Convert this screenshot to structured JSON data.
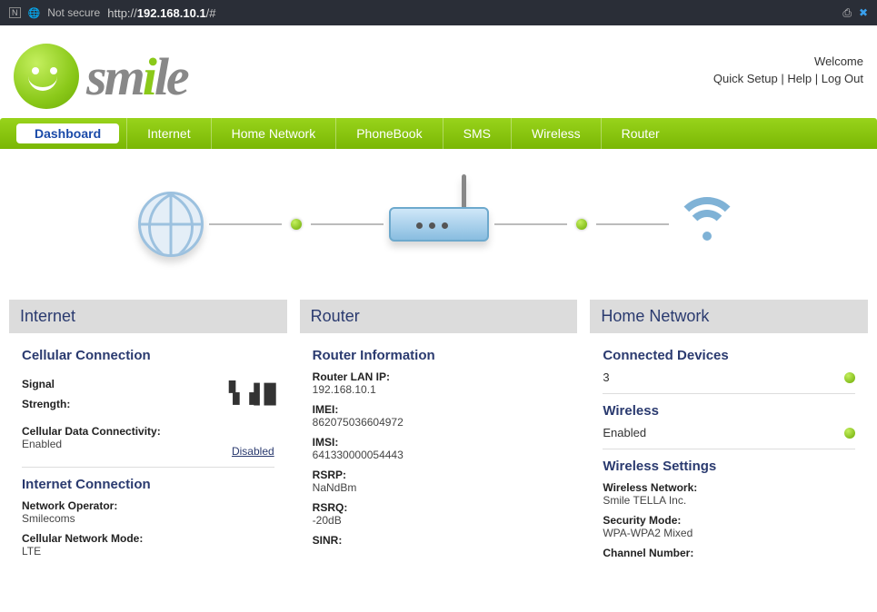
{
  "browser": {
    "not_secure": "Not secure",
    "url_prefix": "http://",
    "url_host": "192.168.10.1",
    "url_suffix": "/#"
  },
  "header": {
    "logo_text": "smile",
    "welcome": "Welcome",
    "quick_setup": "Quick Setup",
    "help": "Help",
    "logout": "Log Out"
  },
  "nav": {
    "dashboard": "Dashboard",
    "internet": "Internet",
    "home_network": "Home Network",
    "phonebook": "PhoneBook",
    "sms": "SMS",
    "wireless": "Wireless",
    "router": "Router"
  },
  "internet_panel": {
    "title": "Internet",
    "cellular_heading": "Cellular Connection",
    "signal_label": "Signal",
    "strength_label": "Strength:",
    "cdc_label": "Cellular Data Connectivity:",
    "cdc_value": "Enabled",
    "disabled_link": "Disabled",
    "ic_heading": "Internet Connection",
    "operator_label": "Network Operator:",
    "operator_value": "Smilecoms",
    "mode_label": "Cellular Network Mode:",
    "mode_value": "LTE"
  },
  "router_panel": {
    "title": "Router",
    "info_heading": "Router Information",
    "lanip_label": "Router LAN IP:",
    "lanip_value": "192.168.10.1",
    "imei_label": "IMEI:",
    "imei_value": "862075036604972",
    "imsi_label": "IMSI:",
    "imsi_value": "641330000054443",
    "rsrp_label": "RSRP:",
    "rsrp_value": "NaNdBm",
    "rsrq_label": "RSRQ:",
    "rsrq_value": "-20dB",
    "sinr_label": "SINR:"
  },
  "home_panel": {
    "title": "Home Network",
    "connected_heading": "Connected Devices",
    "connected_value": "3",
    "wireless_heading": "Wireless",
    "wireless_value": "Enabled",
    "ws_heading": "Wireless Settings",
    "wn_label": "Wireless Network:",
    "wn_value": "Smile TELLA Inc.",
    "sm_label": "Security Mode:",
    "sm_value": "WPA-WPA2 Mixed",
    "cn_label": "Channel Number:"
  }
}
